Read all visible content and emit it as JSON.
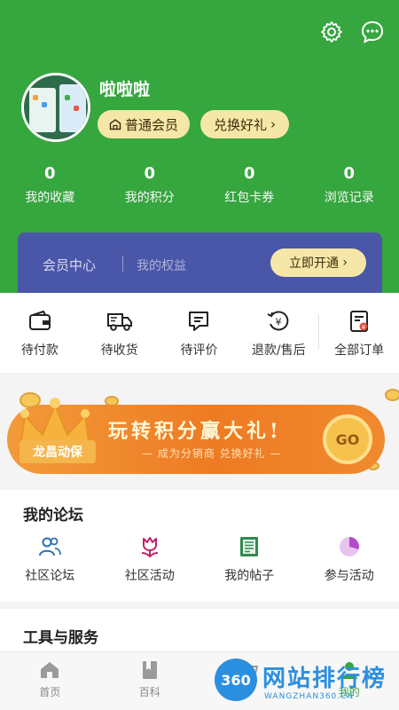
{
  "header": {
    "username": "啦啦啦",
    "member_label": "普通会员",
    "exchange_label": "兑换好礼",
    "settings_icon": "gear-icon",
    "message_icon": "chat-bubble-icon"
  },
  "stats": [
    {
      "value": "0",
      "label": "我的收藏"
    },
    {
      "value": "0",
      "label": "我的积分"
    },
    {
      "value": "0",
      "label": "红包卡券"
    },
    {
      "value": "0",
      "label": "浏览记录"
    }
  ],
  "vip": {
    "title": "会员中心",
    "subtitle": "我的权益",
    "button": "立即开通"
  },
  "orders": [
    {
      "label": "待付款",
      "icon": "wallet-icon"
    },
    {
      "label": "待收货",
      "icon": "truck-icon"
    },
    {
      "label": "待评价",
      "icon": "comment-icon"
    },
    {
      "label": "退款/售后",
      "icon": "refund-icon"
    },
    {
      "label": "全部订单",
      "icon": "order-list-icon"
    }
  ],
  "banner": {
    "logo_text": "龙昌动保",
    "title": "玩转积分赢大礼!",
    "subtitle": "— 成为分销商 兑换好礼 —",
    "go": "GO"
  },
  "forum": {
    "title": "我的论坛",
    "items": [
      {
        "label": "社区论坛",
        "icon": "people-icon"
      },
      {
        "label": "社区活动",
        "icon": "tulip-icon"
      },
      {
        "label": "我的帖子",
        "icon": "newspaper-icon"
      },
      {
        "label": "参与活动",
        "icon": "pie-icon"
      }
    ]
  },
  "tools": {
    "title": "工具与服务"
  },
  "tabbar": [
    {
      "label": "首页",
      "icon": "home-icon"
    },
    {
      "label": "百科",
      "icon": "book-icon"
    },
    {
      "label": "",
      "icon": "cart-icon"
    },
    {
      "label": "我的",
      "icon": "user-icon"
    }
  ],
  "watermark": {
    "badge": "360",
    "text": "网站排行榜",
    "url": "WANGZHAN360.CN"
  },
  "colors": {
    "brand_green": "#36a63f",
    "vip_blue": "#4a56a8",
    "gold": "#f6e7a8",
    "banner_orange": "#ee7b24"
  }
}
